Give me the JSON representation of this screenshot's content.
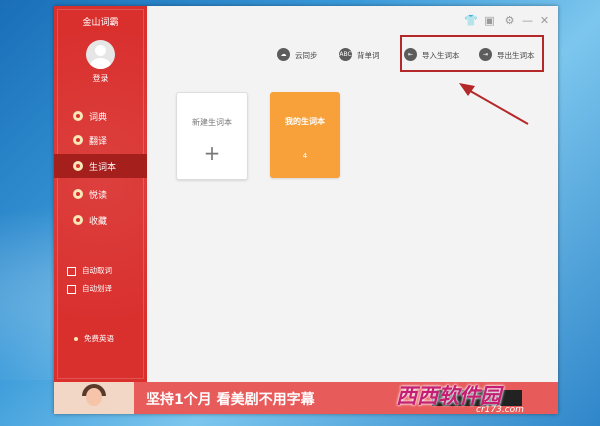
{
  "app": {
    "title": "金山词霸"
  },
  "user": {
    "login_label": "登录"
  },
  "nav": [
    {
      "label": "词典"
    },
    {
      "label": "翻译"
    },
    {
      "label": "生词本"
    },
    {
      "label": "悦读"
    },
    {
      "label": "收藏"
    }
  ],
  "options": {
    "auto_lookup": "自动取词",
    "auto_select": "自动划译"
  },
  "free_english": "免费英语",
  "toolbar": {
    "cloud_sync": {
      "label": "云同步",
      "icon": "cloud-icon"
    },
    "memorize": {
      "label": "背单词",
      "icon": "abc-icon",
      "icon_text": "ABC"
    },
    "import": {
      "label": "导入生词本",
      "icon": "import-icon"
    },
    "export": {
      "label": "导出生词本",
      "icon": "export-icon"
    }
  },
  "cards": {
    "new": {
      "title": "新建生词本",
      "plus": "+"
    },
    "mine": {
      "title": "我的生词本",
      "count": "4"
    }
  },
  "banner": {
    "text": "坚持1个月 看美剧不用字幕"
  },
  "watermark": {
    "text": "西西软件园",
    "sub": "cr173.com"
  },
  "colors": {
    "sidebar": "#d9302e",
    "sidebar_active": "#a5201d",
    "card_mine": "#f8a03a",
    "highlight": "#b4282a"
  }
}
